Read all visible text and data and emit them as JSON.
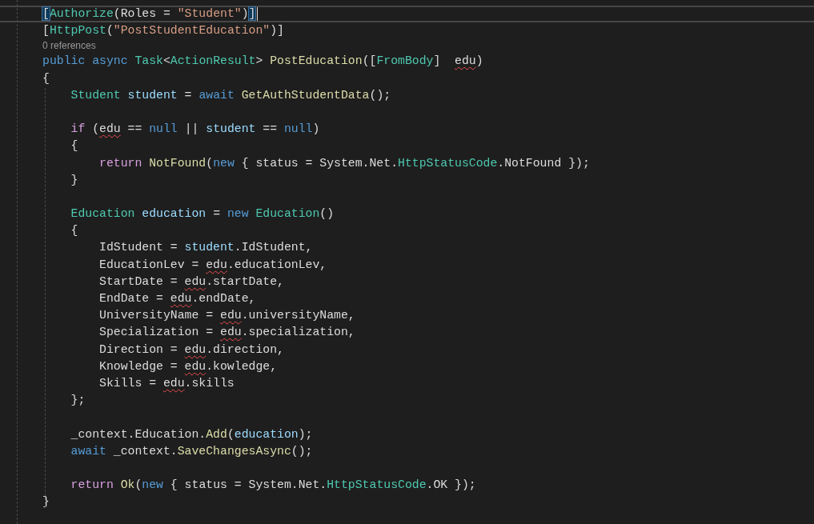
{
  "editor": {
    "lines": [
      {
        "kind": "code",
        "current": true,
        "cursor": true,
        "tokens": [
          {
            "t": "[",
            "kind": "plain",
            "hl": true
          },
          {
            "t": "Authorize",
            "kind": "type"
          },
          {
            "t": "(Roles = ",
            "kind": "plain"
          },
          {
            "t": "\"Student\"",
            "kind": "string"
          },
          {
            "t": ")",
            "kind": "plain"
          },
          {
            "t": "]",
            "kind": "plain",
            "hl": true
          }
        ]
      },
      {
        "kind": "code",
        "current": false,
        "tokens": [
          {
            "t": "[",
            "kind": "plain"
          },
          {
            "t": "HttpPost",
            "kind": "type"
          },
          {
            "t": "(",
            "kind": "plain"
          },
          {
            "t": "\"PostStudentEducation\"",
            "kind": "string"
          },
          {
            "t": ")]",
            "kind": "plain"
          }
        ]
      },
      {
        "kind": "codelens",
        "text": "0 references"
      },
      {
        "kind": "code",
        "current": false,
        "tokens": [
          {
            "t": "public async ",
            "kind": "keyword"
          },
          {
            "t": "Task",
            "kind": "type"
          },
          {
            "t": "<",
            "kind": "plain"
          },
          {
            "t": "ActionResult",
            "kind": "type"
          },
          {
            "t": "> ",
            "kind": "plain"
          },
          {
            "t": "PostEducation",
            "kind": "method"
          },
          {
            "t": "([",
            "kind": "plain"
          },
          {
            "t": "FromBody",
            "kind": "type"
          },
          {
            "t": "]  ",
            "kind": "plain"
          },
          {
            "t": "edu",
            "kind": "plain",
            "err": true
          },
          {
            "t": ")",
            "kind": "plain"
          }
        ]
      },
      {
        "kind": "code",
        "current": false,
        "tokens": [
          {
            "t": "{",
            "kind": "plain"
          }
        ]
      },
      {
        "kind": "code",
        "current": false,
        "tokens": [
          {
            "t": "    Student ",
            "kind": "type"
          },
          {
            "t": "student",
            "kind": "variable"
          },
          {
            "t": " = ",
            "kind": "plain"
          },
          {
            "t": "await ",
            "kind": "keyword"
          },
          {
            "t": "GetAuthStudentData",
            "kind": "method"
          },
          {
            "t": "();",
            "kind": "plain"
          }
        ]
      },
      {
        "kind": "blank"
      },
      {
        "kind": "code",
        "current": false,
        "tokens": [
          {
            "t": "    if",
            "kind": "control"
          },
          {
            "t": " (",
            "kind": "plain"
          },
          {
            "t": "edu",
            "kind": "plain",
            "err": true
          },
          {
            "t": " == ",
            "kind": "plain"
          },
          {
            "t": "null",
            "kind": "keyword"
          },
          {
            "t": " || ",
            "kind": "plain"
          },
          {
            "t": "student",
            "kind": "variable"
          },
          {
            "t": " == ",
            "kind": "plain"
          },
          {
            "t": "null",
            "kind": "keyword"
          },
          {
            "t": ")",
            "kind": "plain"
          }
        ]
      },
      {
        "kind": "code",
        "current": false,
        "tokens": [
          {
            "t": "    {",
            "kind": "plain"
          }
        ]
      },
      {
        "kind": "code",
        "current": false,
        "tokens": [
          {
            "t": "        return ",
            "kind": "control"
          },
          {
            "t": "NotFound",
            "kind": "method"
          },
          {
            "t": "(",
            "kind": "plain"
          },
          {
            "t": "new",
            "kind": "keyword"
          },
          {
            "t": " { status = System.Net.",
            "kind": "plain"
          },
          {
            "t": "HttpStatusCode",
            "kind": "type"
          },
          {
            "t": ".NotFound });",
            "kind": "plain"
          }
        ]
      },
      {
        "kind": "code",
        "current": false,
        "tokens": [
          {
            "t": "    }",
            "kind": "plain"
          }
        ]
      },
      {
        "kind": "blank"
      },
      {
        "kind": "code",
        "current": false,
        "tokens": [
          {
            "t": "    Education ",
            "kind": "type"
          },
          {
            "t": "education",
            "kind": "variable"
          },
          {
            "t": " = ",
            "kind": "plain"
          },
          {
            "t": "new ",
            "kind": "keyword"
          },
          {
            "t": "Education",
            "kind": "type"
          },
          {
            "t": "()",
            "kind": "plain"
          }
        ]
      },
      {
        "kind": "code",
        "current": false,
        "tokens": [
          {
            "t": "    {",
            "kind": "plain"
          }
        ]
      },
      {
        "kind": "code",
        "current": false,
        "tokens": [
          {
            "t": "        IdStudent = ",
            "kind": "plain"
          },
          {
            "t": "student",
            "kind": "variable"
          },
          {
            "t": ".IdStudent,",
            "kind": "plain"
          }
        ]
      },
      {
        "kind": "code",
        "current": false,
        "tokens": [
          {
            "t": "        EducationLev = ",
            "kind": "plain"
          },
          {
            "t": "edu",
            "kind": "plain",
            "err": true
          },
          {
            "t": ".educationLev,",
            "kind": "plain"
          }
        ]
      },
      {
        "kind": "code",
        "current": false,
        "tokens": [
          {
            "t": "        StartDate = ",
            "kind": "plain"
          },
          {
            "t": "edu",
            "kind": "plain",
            "err": true
          },
          {
            "t": ".startDate,",
            "kind": "plain"
          }
        ]
      },
      {
        "kind": "code",
        "current": false,
        "tokens": [
          {
            "t": "        EndDate = ",
            "kind": "plain"
          },
          {
            "t": "edu",
            "kind": "plain",
            "err": true
          },
          {
            "t": ".endDate,",
            "kind": "plain"
          }
        ]
      },
      {
        "kind": "code",
        "current": false,
        "tokens": [
          {
            "t": "        UniversityName = ",
            "kind": "plain"
          },
          {
            "t": "edu",
            "kind": "plain",
            "err": true
          },
          {
            "t": ".universityName,",
            "kind": "plain"
          }
        ]
      },
      {
        "kind": "code",
        "current": false,
        "tokens": [
          {
            "t": "        Specialization = ",
            "kind": "plain"
          },
          {
            "t": "edu",
            "kind": "plain",
            "err": true
          },
          {
            "t": ".specialization,",
            "kind": "plain"
          }
        ]
      },
      {
        "kind": "code",
        "current": false,
        "tokens": [
          {
            "t": "        Direction = ",
            "kind": "plain"
          },
          {
            "t": "edu",
            "kind": "plain",
            "err": true
          },
          {
            "t": ".direction,",
            "kind": "plain"
          }
        ]
      },
      {
        "kind": "code",
        "current": false,
        "tokens": [
          {
            "t": "        Knowledge = ",
            "kind": "plain"
          },
          {
            "t": "edu",
            "kind": "plain",
            "err": true
          },
          {
            "t": ".kowledge,",
            "kind": "plain"
          }
        ]
      },
      {
        "kind": "code",
        "current": false,
        "tokens": [
          {
            "t": "        Skills = ",
            "kind": "plain"
          },
          {
            "t": "edu",
            "kind": "plain",
            "err": true
          },
          {
            "t": ".skills",
            "kind": "plain"
          }
        ]
      },
      {
        "kind": "code",
        "current": false,
        "tokens": [
          {
            "t": "    };",
            "kind": "plain"
          }
        ]
      },
      {
        "kind": "blank"
      },
      {
        "kind": "code",
        "current": false,
        "tokens": [
          {
            "t": "    _context.Education.",
            "kind": "plain"
          },
          {
            "t": "Add",
            "kind": "method"
          },
          {
            "t": "(",
            "kind": "plain"
          },
          {
            "t": "education",
            "kind": "variable"
          },
          {
            "t": ");",
            "kind": "plain"
          }
        ]
      },
      {
        "kind": "code",
        "current": false,
        "tokens": [
          {
            "t": "    await",
            "kind": "keyword"
          },
          {
            "t": " _context.",
            "kind": "plain"
          },
          {
            "t": "SaveChangesAsync",
            "kind": "method"
          },
          {
            "t": "();",
            "kind": "plain"
          }
        ]
      },
      {
        "kind": "blank"
      },
      {
        "kind": "code",
        "current": false,
        "tokens": [
          {
            "t": "    return ",
            "kind": "control"
          },
          {
            "t": "Ok",
            "kind": "method"
          },
          {
            "t": "(",
            "kind": "plain"
          },
          {
            "t": "new",
            "kind": "keyword"
          },
          {
            "t": " { status = System.Net.",
            "kind": "plain"
          },
          {
            "t": "HttpStatusCode",
            "kind": "type"
          },
          {
            "t": ".OK });",
            "kind": "plain"
          }
        ]
      },
      {
        "kind": "code",
        "current": false,
        "tokens": [
          {
            "t": "}",
            "kind": "plain"
          }
        ]
      }
    ]
  }
}
